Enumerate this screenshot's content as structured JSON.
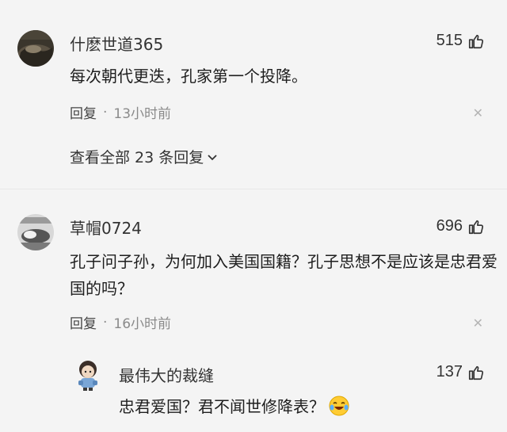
{
  "comments": [
    {
      "username": "什麽世道365",
      "likes": "515",
      "text": "每次朝代更迭，孔家第一个投降。",
      "reply_label": "回复",
      "separator": "·",
      "time": "13小时前",
      "view_replies": "查看全部 23 条回复",
      "avatar_icon": "landscape-avatar-icon"
    },
    {
      "username": "草帽0724",
      "likes": "696",
      "text": "孔子问子孙，为何加入美国国籍？孔子思想不是应该是忠君爱国的吗？",
      "reply_label": "回复",
      "separator": "·",
      "time": "16小时前",
      "avatar_icon": "photo-avatar-icon"
    }
  ],
  "reply": {
    "username": "最伟大的裁缝",
    "likes": "137",
    "text": "忠君爱国？君不闻世修降表？",
    "emoji": "laughing-crying-emoji",
    "avatar_icon": "character-avatar-icon"
  },
  "colors": {
    "background": "#f4f4f4",
    "text": "#1e1e1e",
    "meta": "#8a8a8a"
  }
}
